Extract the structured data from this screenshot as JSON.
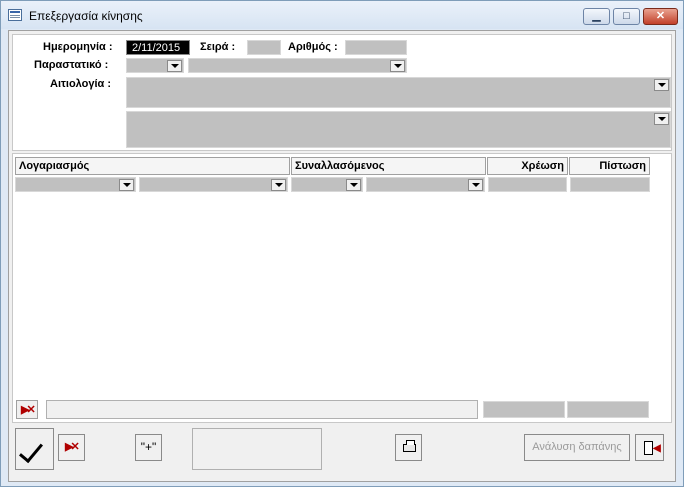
{
  "window": {
    "title": "Επεξεργασία κίνησης",
    "icon": "form-window-icon",
    "minimize_glyph": "▁",
    "maximize_glyph": "□",
    "close_glyph": "✕"
  },
  "header": {
    "date_label": "Ημερομηνία :",
    "date_value": "2/11/2015",
    "series_label": "Σειρά :",
    "series_value": "",
    "number_label": "Αριθμός :",
    "number_value": "",
    "document_label": "Παραστατικό :",
    "reason_label": "Αιτιολογία :"
  },
  "grid": {
    "columns": [
      "Λογαριασμός",
      "Συναλλασόμενος",
      "Χρέωση",
      "Πίστωση"
    ]
  },
  "footer": {
    "add_label": "\"+\"",
    "analysis_label": "Ανάλυση δαπάνης"
  },
  "icons": {
    "ok": "checkmark-icon",
    "cancel": "cancel-x-icon",
    "print": "printer-icon",
    "exit": "exit-door-icon",
    "delete_row": "delete-row-icon"
  },
  "colors": {
    "field_bg": "#c0c0c0",
    "selected_bg": "#000000",
    "disabled_text": "#9a9a9a",
    "cancel_red": "#b00000"
  }
}
